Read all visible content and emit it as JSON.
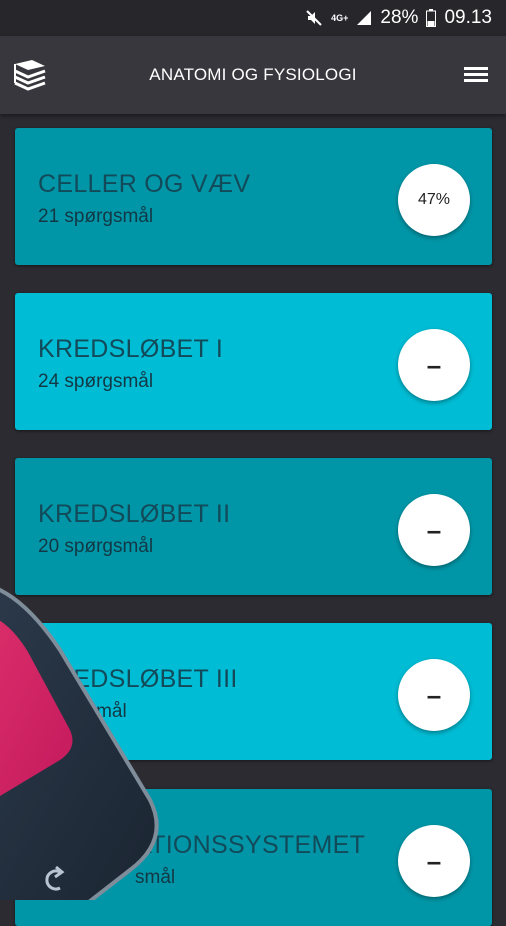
{
  "status_bar": {
    "network": "4G+",
    "battery": "28%",
    "time": "09.13",
    "icons": [
      "mute-icon",
      "network-4g-icon",
      "signal-icon",
      "battery-icon"
    ]
  },
  "app_bar": {
    "title": "ANATOMI OG FYSIOLOGI",
    "left_icon": "books-icon",
    "right_icon": "menu-icon"
  },
  "colors": {
    "card_dark": "#0096a7",
    "card_light": "#00bcd4",
    "background": "#2b2b31",
    "app_bar": "#37373d"
  },
  "cards": [
    {
      "title": "CELLER OG VÆV",
      "subtitle": "21 spørgsmål",
      "badge": "47%",
      "progress_percent": 47
    },
    {
      "title": "KREDSLØBET I",
      "subtitle": "24 spørgsmål",
      "badge": "–"
    },
    {
      "title": "KREDSLØBET II",
      "subtitle": "20 spørgsmål",
      "badge": "–"
    },
    {
      "title": "KREDSLØBET III",
      "subtitle": "spørgsmål",
      "badge": "–"
    },
    {
      "title": "ATIONSSYSTEMET",
      "subtitle": "smål",
      "badge": "–"
    }
  ]
}
